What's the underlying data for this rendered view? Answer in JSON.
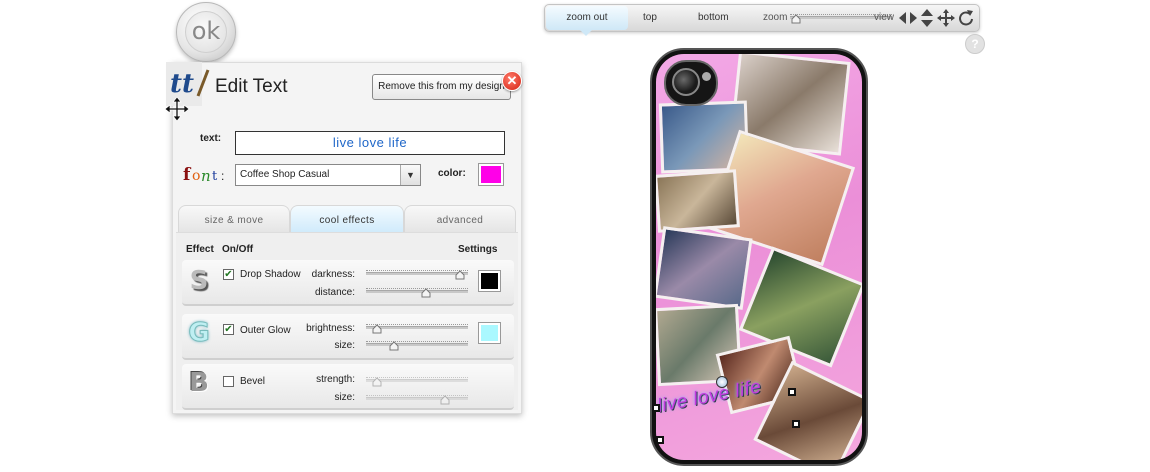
{
  "ok_button": {
    "label": "ok"
  },
  "panel": {
    "title": "Edit Text",
    "remove_button": "Remove this from my design",
    "text_label": "text:",
    "text_value": "live love life",
    "font_label": ":",
    "font_value": "Coffee Shop Casual",
    "color_label": "color:",
    "color_value": "#ff00e8"
  },
  "tabs": [
    {
      "label": "size & move"
    },
    {
      "label": "cool effects",
      "selected": true
    },
    {
      "label": "advanced"
    }
  ],
  "effects_header": {
    "effect": "Effect",
    "onoff": "On/Off",
    "settings": "Settings"
  },
  "effects": [
    {
      "letter": "S",
      "name": "Drop Shadow",
      "enabled": true,
      "params": [
        {
          "label": "darkness:",
          "level": 0.97
        },
        {
          "label": "distance:",
          "level": 0.6
        }
      ],
      "color": "#000000"
    },
    {
      "letter": "G",
      "name": "Outer Glow",
      "enabled": true,
      "params": [
        {
          "label": "brightness:",
          "level": 0.07
        },
        {
          "label": "size:",
          "level": 0.25
        }
      ],
      "color": "#aaf8ff"
    },
    {
      "letter": "B",
      "name": "Bevel",
      "enabled": false,
      "params": [
        {
          "label": "strength:",
          "level": 0.07
        },
        {
          "label": "size:",
          "level": 0.8
        }
      ]
    }
  ],
  "toolbar": {
    "zoom_out": "zoom out",
    "top": "top",
    "bottom": "bottom",
    "zoom": "zoom",
    "zoom_level": 0.02,
    "view": "view"
  },
  "help": {
    "label": "?"
  },
  "phone": {
    "case_color": "#111111",
    "design_text": "live love life",
    "design_text_color": "#c43be0"
  },
  "icons": [
    "tt-logo-icon",
    "move-icon",
    "close-icon",
    "font-logo-icon",
    "dropdown-arrow-icon",
    "arrow-left-icon",
    "arrow-right-icon",
    "arrow-up-icon",
    "arrow-down-icon",
    "move-cross-icon",
    "rotate-icon",
    "help-icon",
    "camera-icon"
  ]
}
